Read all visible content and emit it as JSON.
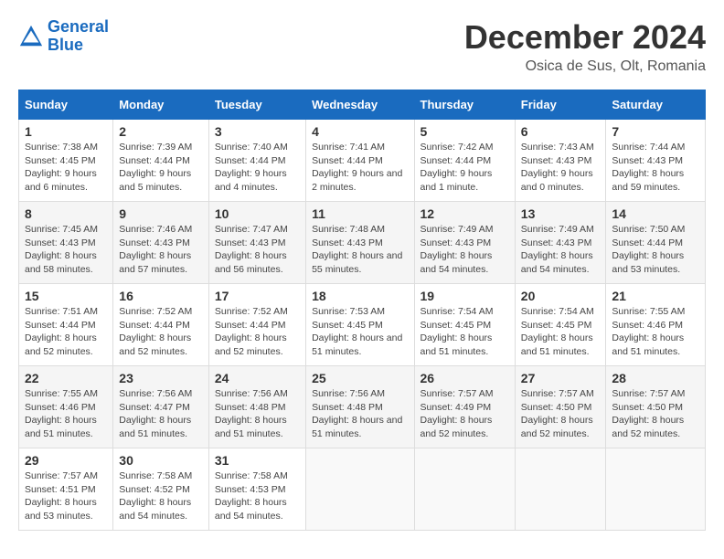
{
  "logo": {
    "line1": "General",
    "line2": "Blue"
  },
  "title": "December 2024",
  "subtitle": "Osica de Sus, Olt, Romania",
  "calendar": {
    "headers": [
      "Sunday",
      "Monday",
      "Tuesday",
      "Wednesday",
      "Thursday",
      "Friday",
      "Saturday"
    ],
    "rows": [
      [
        {
          "day": "1",
          "sunrise": "7:38 AM",
          "sunset": "4:45 PM",
          "daylight": "9 hours and 6 minutes."
        },
        {
          "day": "2",
          "sunrise": "7:39 AM",
          "sunset": "4:44 PM",
          "daylight": "9 hours and 5 minutes."
        },
        {
          "day": "3",
          "sunrise": "7:40 AM",
          "sunset": "4:44 PM",
          "daylight": "9 hours and 4 minutes."
        },
        {
          "day": "4",
          "sunrise": "7:41 AM",
          "sunset": "4:44 PM",
          "daylight": "9 hours and 2 minutes."
        },
        {
          "day": "5",
          "sunrise": "7:42 AM",
          "sunset": "4:44 PM",
          "daylight": "9 hours and 1 minute."
        },
        {
          "day": "6",
          "sunrise": "7:43 AM",
          "sunset": "4:43 PM",
          "daylight": "9 hours and 0 minutes."
        },
        {
          "day": "7",
          "sunrise": "7:44 AM",
          "sunset": "4:43 PM",
          "daylight": "8 hours and 59 minutes."
        }
      ],
      [
        {
          "day": "8",
          "sunrise": "7:45 AM",
          "sunset": "4:43 PM",
          "daylight": "8 hours and 58 minutes."
        },
        {
          "day": "9",
          "sunrise": "7:46 AM",
          "sunset": "4:43 PM",
          "daylight": "8 hours and 57 minutes."
        },
        {
          "day": "10",
          "sunrise": "7:47 AM",
          "sunset": "4:43 PM",
          "daylight": "8 hours and 56 minutes."
        },
        {
          "day": "11",
          "sunrise": "7:48 AM",
          "sunset": "4:43 PM",
          "daylight": "8 hours and 55 minutes."
        },
        {
          "day": "12",
          "sunrise": "7:49 AM",
          "sunset": "4:43 PM",
          "daylight": "8 hours and 54 minutes."
        },
        {
          "day": "13",
          "sunrise": "7:49 AM",
          "sunset": "4:43 PM",
          "daylight": "8 hours and 54 minutes."
        },
        {
          "day": "14",
          "sunrise": "7:50 AM",
          "sunset": "4:44 PM",
          "daylight": "8 hours and 53 minutes."
        }
      ],
      [
        {
          "day": "15",
          "sunrise": "7:51 AM",
          "sunset": "4:44 PM",
          "daylight": "8 hours and 52 minutes."
        },
        {
          "day": "16",
          "sunrise": "7:52 AM",
          "sunset": "4:44 PM",
          "daylight": "8 hours and 52 minutes."
        },
        {
          "day": "17",
          "sunrise": "7:52 AM",
          "sunset": "4:44 PM",
          "daylight": "8 hours and 52 minutes."
        },
        {
          "day": "18",
          "sunrise": "7:53 AM",
          "sunset": "4:45 PM",
          "daylight": "8 hours and 51 minutes."
        },
        {
          "day": "19",
          "sunrise": "7:54 AM",
          "sunset": "4:45 PM",
          "daylight": "8 hours and 51 minutes."
        },
        {
          "day": "20",
          "sunrise": "7:54 AM",
          "sunset": "4:45 PM",
          "daylight": "8 hours and 51 minutes."
        },
        {
          "day": "21",
          "sunrise": "7:55 AM",
          "sunset": "4:46 PM",
          "daylight": "8 hours and 51 minutes."
        }
      ],
      [
        {
          "day": "22",
          "sunrise": "7:55 AM",
          "sunset": "4:46 PM",
          "daylight": "8 hours and 51 minutes."
        },
        {
          "day": "23",
          "sunrise": "7:56 AM",
          "sunset": "4:47 PM",
          "daylight": "8 hours and 51 minutes."
        },
        {
          "day": "24",
          "sunrise": "7:56 AM",
          "sunset": "4:48 PM",
          "daylight": "8 hours and 51 minutes."
        },
        {
          "day": "25",
          "sunrise": "7:56 AM",
          "sunset": "4:48 PM",
          "daylight": "8 hours and 51 minutes."
        },
        {
          "day": "26",
          "sunrise": "7:57 AM",
          "sunset": "4:49 PM",
          "daylight": "8 hours and 52 minutes."
        },
        {
          "day": "27",
          "sunrise": "7:57 AM",
          "sunset": "4:50 PM",
          "daylight": "8 hours and 52 minutes."
        },
        {
          "day": "28",
          "sunrise": "7:57 AM",
          "sunset": "4:50 PM",
          "daylight": "8 hours and 52 minutes."
        }
      ],
      [
        {
          "day": "29",
          "sunrise": "7:57 AM",
          "sunset": "4:51 PM",
          "daylight": "8 hours and 53 minutes."
        },
        {
          "day": "30",
          "sunrise": "7:58 AM",
          "sunset": "4:52 PM",
          "daylight": "8 hours and 54 minutes."
        },
        {
          "day": "31",
          "sunrise": "7:58 AM",
          "sunset": "4:53 PM",
          "daylight": "8 hours and 54 minutes."
        },
        null,
        null,
        null,
        null
      ]
    ]
  }
}
